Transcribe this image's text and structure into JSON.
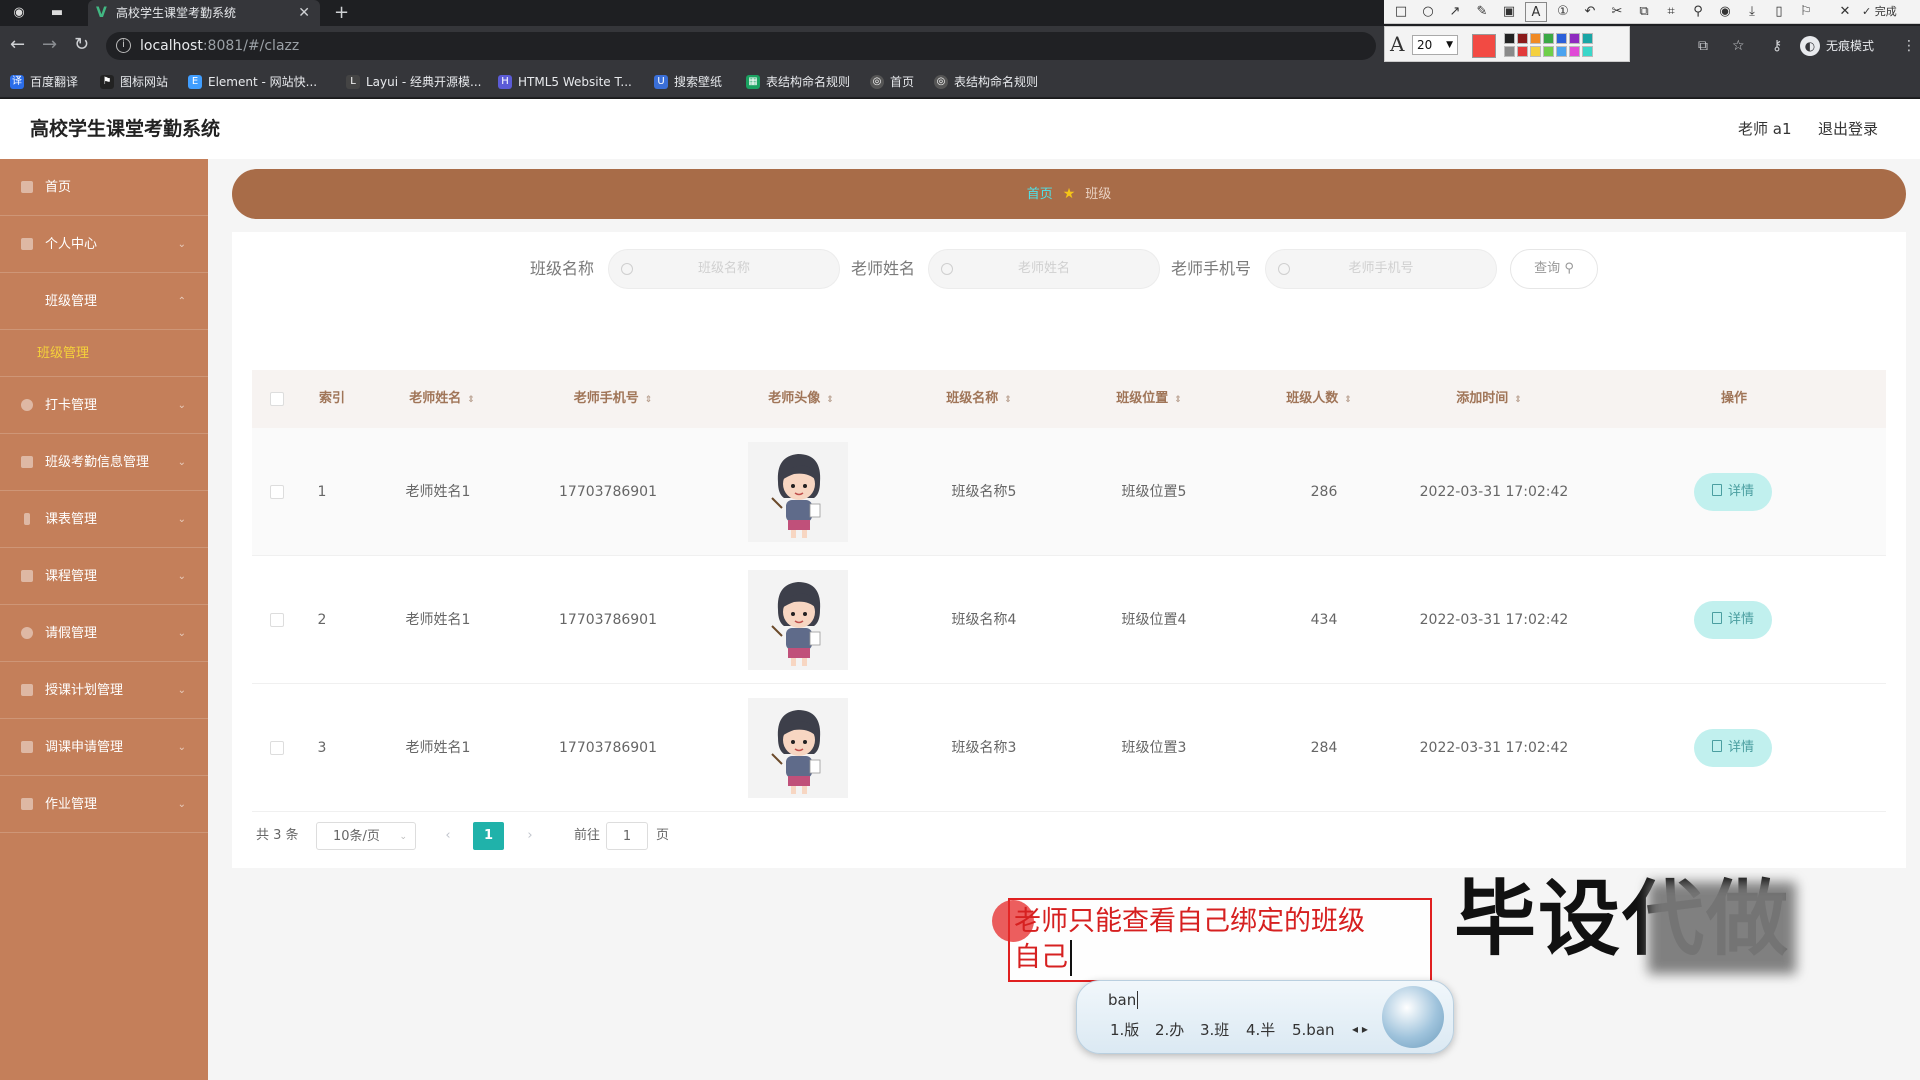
{
  "browser": {
    "tab_title": "高校学生课堂考勤系统",
    "url_host": "localhost",
    "url_path": ":8081/#/clazz",
    "incognito_label": "无痕模式",
    "bookmarks": [
      {
        "label": "百度翻译",
        "color": "#2b6de8"
      },
      {
        "label": "图标网站",
        "color": "#222222"
      },
      {
        "label": "Element - 网站快...",
        "color": "#409eff"
      },
      {
        "label": "Layui - 经典开源模...",
        "color": "#444444"
      },
      {
        "label": "HTML5 Website T...",
        "color": "#5b5bd6"
      },
      {
        "label": "搜索壁纸",
        "color": "#3a6fd8"
      },
      {
        "label": "表结构命名规则",
        "color": "#1aa260"
      },
      {
        "label": "首页",
        "color": "#555555"
      },
      {
        "label": "表结构命名规则",
        "color": "#555555"
      }
    ]
  },
  "annotation_toolbar": {
    "font_size": "20",
    "finish_label": "完成",
    "current_color": "#f24a43"
  },
  "app": {
    "title": "高校学生课堂考勤系统",
    "user": "老师 a1",
    "logout": "退出登录"
  },
  "sidebar": {
    "items": [
      {
        "label": "首页"
      },
      {
        "label": "个人中心"
      },
      {
        "label": "班级管理"
      },
      {
        "label": "打卡管理"
      },
      {
        "label": "班级考勤信息管理"
      },
      {
        "label": "课表管理"
      },
      {
        "label": "课程管理"
      },
      {
        "label": "请假管理"
      },
      {
        "label": "授课计划管理"
      },
      {
        "label": "调课申请管理"
      },
      {
        "label": "作业管理"
      }
    ],
    "active_sub": "班级管理"
  },
  "breadcrumb": {
    "home": "首页",
    "current": "班级"
  },
  "filters": {
    "class_name_label": "班级名称",
    "class_name_placeholder": "班级名称",
    "teacher_name_label": "老师姓名",
    "teacher_name_placeholder": "老师姓名",
    "teacher_phone_label": "老师手机号",
    "teacher_phone_placeholder": "老师手机号",
    "query_label": "查询"
  },
  "table": {
    "columns": [
      "索引",
      "老师姓名",
      "老师手机号",
      "老师头像",
      "班级名称",
      "班级位置",
      "班级人数",
      "添加时间",
      "操作"
    ],
    "rows": [
      {
        "index": "1",
        "teacher": "老师姓名1",
        "phone": "17703786901",
        "class_name": "班级名称5",
        "location": "班级位置5",
        "count": "286",
        "time": "2022-03-31 17:02:42"
      },
      {
        "index": "2",
        "teacher": "老师姓名1",
        "phone": "17703786901",
        "class_name": "班级名称4",
        "location": "班级位置4",
        "count": "434",
        "time": "2022-03-31 17:02:42"
      },
      {
        "index": "3",
        "teacher": "老师姓名1",
        "phone": "17703786901",
        "class_name": "班级名称3",
        "location": "班级位置3",
        "count": "284",
        "time": "2022-03-31 17:02:42"
      }
    ],
    "detail_label": "详情"
  },
  "pagination": {
    "total": "共 3 条",
    "page_size": "10条/页",
    "current_page": "1",
    "goto_prefix": "前往",
    "goto_value": "1",
    "goto_suffix": "页"
  },
  "overlay": {
    "note_line1": "老师只能查看自己绑定的班级",
    "note_line2": "自己",
    "watermark": "毕设代做",
    "ime_composition": "ban",
    "ime_candidates": [
      "1.版",
      "2.办",
      "3.班",
      "4.半",
      "5.ban"
    ]
  }
}
